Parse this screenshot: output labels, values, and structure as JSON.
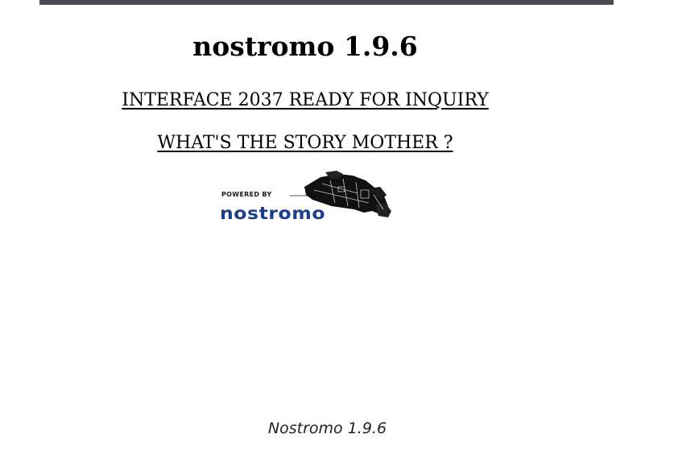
{
  "page": {
    "title": "nostromo 1.9.6"
  },
  "links": {
    "interface": "INTERFACE 2037 READY FOR INQUIRY",
    "story": "WHAT'S THE STORY MOTHER ?"
  },
  "badge": {
    "powered_by": "POWERED BY",
    "brand": "nostromo",
    "ship_icon": "spaceship-icon",
    "brand_color": "#1c3e8c"
  },
  "footer": {
    "text": "Nostromo 1.9.6"
  }
}
